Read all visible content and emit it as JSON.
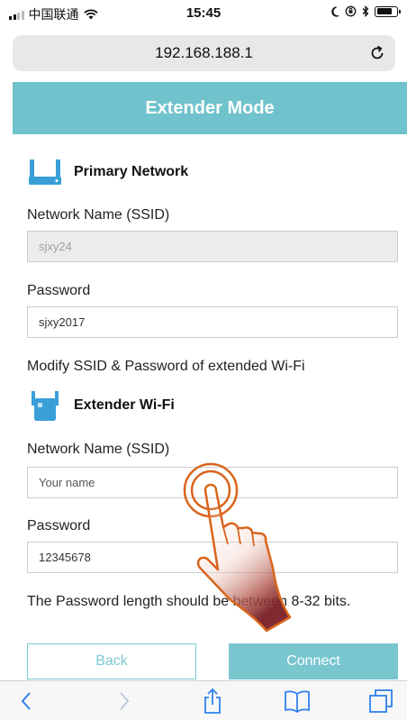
{
  "status_bar": {
    "carrier": "中国联通",
    "time": "15:45",
    "icons": [
      "signal-icon",
      "wifi-icon",
      "moon-icon",
      "orientation-lock-icon",
      "bluetooth-icon",
      "battery-icon"
    ]
  },
  "browser": {
    "url": "192.168.188.1",
    "reload_icon": "reload-icon"
  },
  "header": {
    "title": "Extender Mode"
  },
  "primary": {
    "title": "Primary Network",
    "icon": "router-icon",
    "ssid_label": "Network Name (SSID)",
    "ssid_value": "sjxy24",
    "password_label": "Password",
    "password_value": "sjxy2017"
  },
  "modify_note": "Modify SSID & Password of extended Wi-Fi",
  "extender": {
    "title": "Extender Wi-Fi",
    "icon": "extender-icon",
    "ssid_label": "Network Name (SSID)",
    "ssid_placeholder": "Your name",
    "password_label": "Password",
    "password_value": "12345678"
  },
  "password_hint": "The Password length should be between 8-32 bits.",
  "buttons": {
    "back": "Back",
    "connect": "Connect"
  },
  "toolbar": {
    "icons": [
      "back-arrow-icon",
      "forward-arrow-icon",
      "share-icon",
      "bookmarks-icon",
      "tabs-icon"
    ]
  },
  "colors": {
    "accent": "#70c2cc",
    "icon_blue": "#3a9fd8",
    "hand_outline": "#d9651d"
  }
}
